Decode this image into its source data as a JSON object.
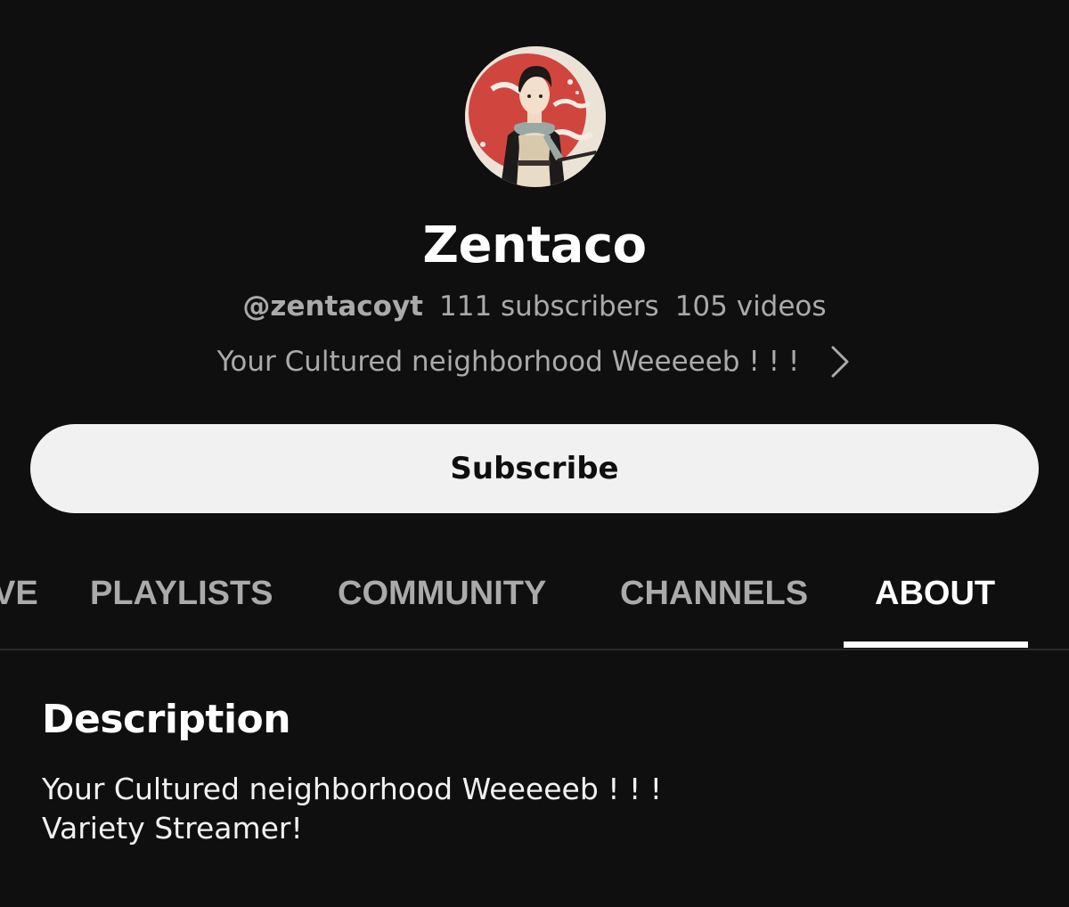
{
  "channel": {
    "name": "Zentaco",
    "handle": "@zentacoyt",
    "subscribers": "111 subscribers",
    "videos": "105 videos",
    "tagline": "Your Cultured neighborhood Weeeeeb ! ! !",
    "avatar_icon": "avatar-anime-character"
  },
  "subscribe": {
    "label": "Subscribe"
  },
  "tabs": [
    {
      "label": "LIVE",
      "visible_text": "VE",
      "active": false
    },
    {
      "label": "PLAYLISTS",
      "visible_text": "PLAYLISTS",
      "active": false
    },
    {
      "label": "COMMUNITY",
      "visible_text": "COMMUNITY",
      "active": false
    },
    {
      "label": "CHANNELS",
      "visible_text": "CHANNELS",
      "active": false
    },
    {
      "label": "ABOUT",
      "visible_text": "ABOUT",
      "active": true
    }
  ],
  "about": {
    "heading": "Description",
    "description_lines": [
      "Your Cultured neighborhood Weeeeeb ! ! !",
      "Variety Streamer!"
    ]
  },
  "colors": {
    "background": "#0f0f0f",
    "primary_text": "#f1f1f1",
    "secondary_text": "#aaaaaa",
    "button_bg": "#f1f1f1",
    "avatar_red": "#d0463f"
  }
}
